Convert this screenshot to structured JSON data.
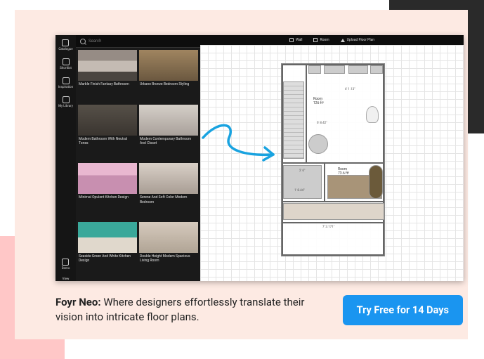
{
  "rail": {
    "items": [
      {
        "label": "Catalogue"
      },
      {
        "label": "Shortlist"
      },
      {
        "label": "Inspiration"
      },
      {
        "label": "My Library"
      }
    ],
    "bottom": [
      {
        "label": "Demo"
      },
      {
        "label": "View"
      }
    ]
  },
  "search": {
    "placeholder": "Search"
  },
  "topbar": {
    "wall": "Wall",
    "room": "Room",
    "upload": "Upload Floor Plan"
  },
  "cards": [
    {
      "title": "Marble Finish Fantasy Bathroom"
    },
    {
      "title": "Urbane Bronze Bedroom Styling"
    },
    {
      "title": "Modern Bathroom With Neutral Tones"
    },
    {
      "title": "Modern Contemporary Bathroom And Closet"
    },
    {
      "title": "Minimal Opulent Kitchen Design"
    },
    {
      "title": "Serene And Soft Color Modern Bedroom"
    },
    {
      "title": "Seaside Green And White Kitchen Design"
    },
    {
      "title": "Double Height Modern Spacious Living Room"
    }
  ],
  "plan": {
    "room1": {
      "name": "Room",
      "dim": "126 ft²"
    },
    "room2": {
      "name": "Room",
      "dim": "73.6 ft²"
    },
    "d1": "4' 1.13\"",
    "d2": "6' 8.42\"",
    "d3": "2' 6\"",
    "d4": "1' 8.44\"",
    "d5": "7' 3.171\""
  },
  "caption": {
    "brand": "Foyr Neo:",
    "text": " Where designers effortlessly translate their vision into intricate floor plans."
  },
  "cta": "Try Free for 14 Days"
}
